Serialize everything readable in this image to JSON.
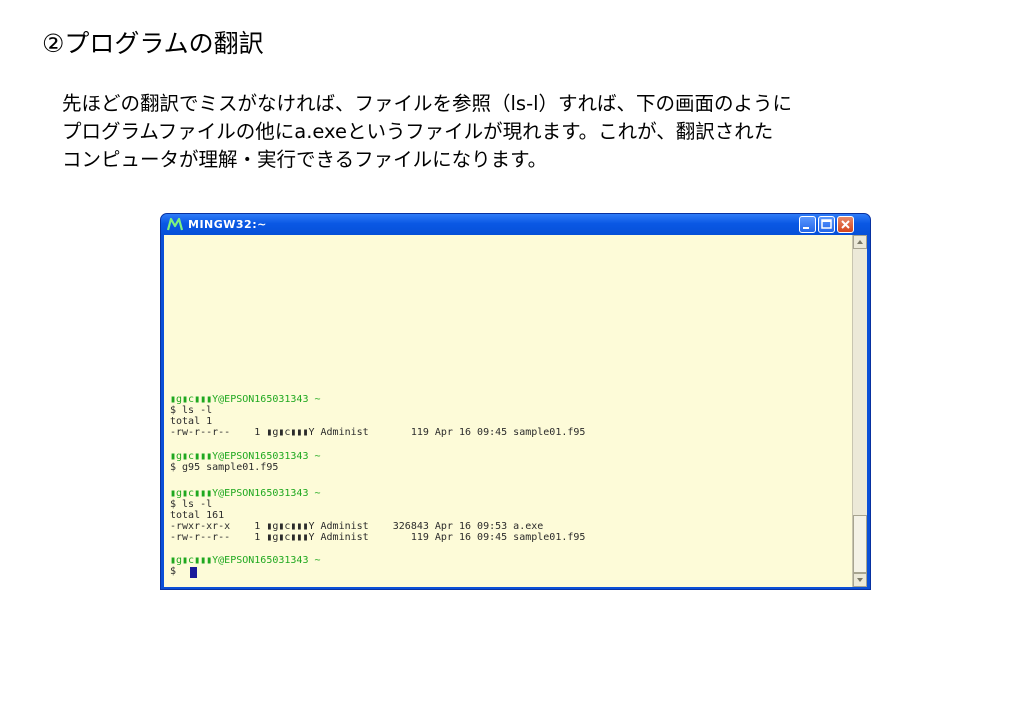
{
  "slide": {
    "heading": "②プログラムの翻訳",
    "paragraph_lines": [
      "先ほどの翻訳でミスがなければ、ファイルを参照（ls-l）すれば、下の画面のように",
      "プログラムファイルの他にa.exeというファイルが現れます。これが、翻訳された",
      "コンピュータが理解・実行できるファイルになります。"
    ]
  },
  "window": {
    "title": "MINGW32:~",
    "icon": "mingw-m-icon",
    "colors": {
      "titlebar": "#0a58e4",
      "console_bg": "#fdfbd8",
      "prompt": "#1fa81f",
      "text": "#2b2b2b"
    }
  },
  "console": {
    "lines": [
      {
        "text": "▮g▮c▮▮▮Y@EPSON165031343 ~",
        "style": "green"
      },
      {
        "text": "$ ls -l",
        "style": "normal"
      },
      {
        "text": "total 1",
        "style": "normal"
      },
      {
        "text": "-rw-r--r--    1 ▮g▮c▮▮▮Y Administ       119 Apr 16 09:45 sample01.f95",
        "style": "normal"
      },
      {
        "text": "▮g▮c▮▮▮Y@EPSON165031343 ~",
        "style": "green"
      },
      {
        "text": "$ g95 sample01.f95",
        "style": "normal"
      },
      {
        "text": "▮g▮c▮▮▮Y@EPSON165031343 ~",
        "style": "green"
      },
      {
        "text": "$ ls -l",
        "style": "normal"
      },
      {
        "text": "total 161",
        "style": "normal"
      },
      {
        "text": "-rwxr-xr-x    1 ▮g▮c▮▮▮Y Administ    326843 Apr 16 09:53 a.exe",
        "style": "normal"
      },
      {
        "text": "-rw-r--r--    1 ▮g▮c▮▮▮Y Administ       119 Apr 16 09:45 sample01.f95",
        "style": "normal"
      },
      {
        "text": "▮g▮c▮▮▮Y@EPSON165031343 ~",
        "style": "green"
      },
      {
        "text": "$",
        "style": "normal"
      }
    ]
  }
}
